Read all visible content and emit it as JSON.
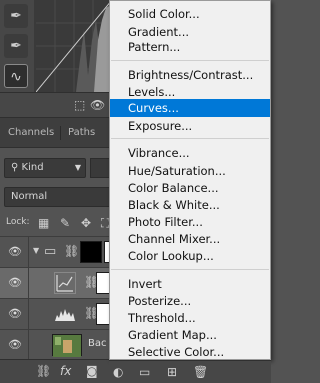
{
  "properties": {
    "tools": [
      {
        "icon": "eyedropper-icon"
      },
      {
        "icon": "eyedropper-plus-icon"
      },
      {
        "icon": "curve-icon"
      }
    ]
  },
  "tabs": {
    "channels": "Channels",
    "paths": "Paths"
  },
  "filter": {
    "kind_label": "Kind"
  },
  "blend": {
    "mode": "Normal"
  },
  "lock": {
    "label": "Lock:"
  },
  "layers": [
    {
      "type": "group",
      "selected": false
    },
    {
      "type": "adjustment-levels",
      "selected": true
    },
    {
      "type": "adjustment-curves",
      "selected": false
    },
    {
      "type": "image",
      "name": "Bac",
      "selected": false
    }
  ],
  "menu": {
    "groups": [
      [
        "Solid Color...",
        "Gradient...",
        "Pattern..."
      ],
      [
        "Brightness/Contrast...",
        "Levels...",
        "Curves...",
        "Exposure..."
      ],
      [
        "Vibrance...",
        "Hue/Saturation...",
        "Color Balance...",
        "Black & White...",
        "Photo Filter...",
        "Channel Mixer...",
        "Color Lookup..."
      ],
      [
        "Invert",
        "Posterize...",
        "Threshold...",
        "Gradient Map...",
        "Selective Color..."
      ]
    ],
    "highlighted": "Curves..."
  },
  "colors": {
    "menu_highlight": "#0078d7",
    "panel_bg": "#535353",
    "menu_bg": "#f0f0f0"
  }
}
